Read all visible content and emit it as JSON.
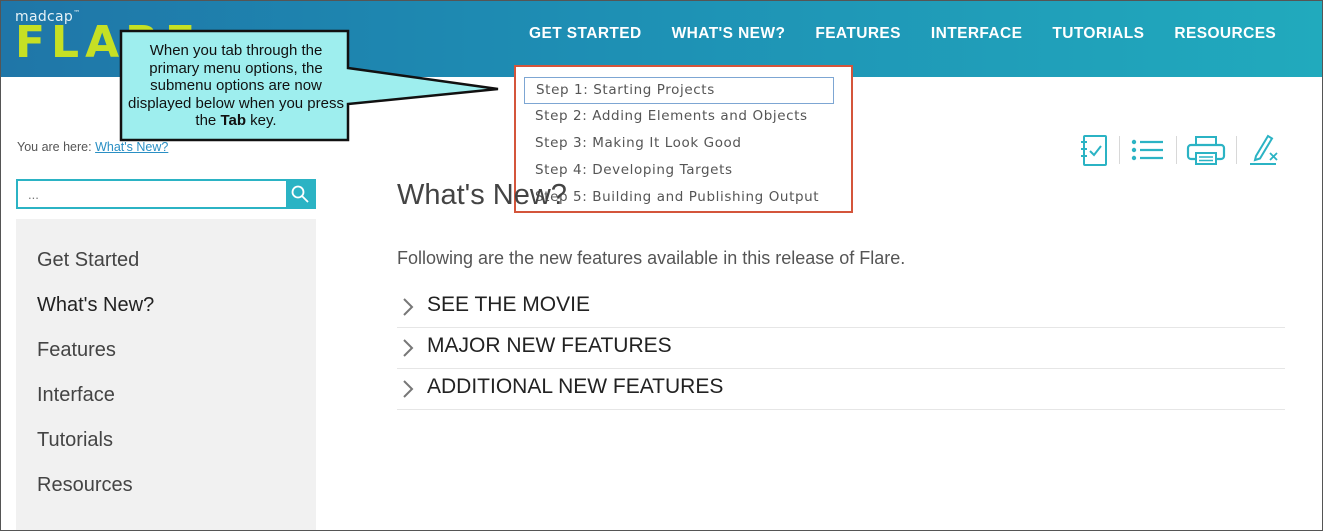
{
  "header": {
    "logo_alt": "madcap",
    "logo_tm": "™",
    "logo_text": "FLARE",
    "nav": [
      "GET STARTED",
      "WHAT'S NEW?",
      "FEATURES",
      "INTERFACE",
      "TUTORIALS",
      "RESOURCES"
    ]
  },
  "callout": {
    "text_before": "When you tab through the primary menu options, the submenu options are now displayed below when you press the ",
    "bold": "Tab",
    "text_after": " key."
  },
  "submenu": {
    "items": [
      "Step 1: Starting Projects",
      "Step 2: Adding Elements and Objects",
      "Step 3: Making It Look Good",
      "Step 4: Developing Targets",
      "Step 5: Building and Publishing Output"
    ],
    "active_index": 0
  },
  "breadcrumb": {
    "prefix": "You are here: ",
    "link": "What's New?"
  },
  "search": {
    "placeholder": "..."
  },
  "sidenav": {
    "items": [
      "Get Started",
      "What's New?",
      "Features",
      "Interface",
      "Tutorials",
      "Resources"
    ],
    "current": "What's New?"
  },
  "toolbar": {
    "icons": [
      "checklist-icon",
      "list-icon",
      "print-icon",
      "clear-highlight-icon"
    ]
  },
  "main": {
    "title": "What's New?",
    "intro": "Following are the new features available in this release of Flare.",
    "dropdowns": [
      "SEE THE MOVIE",
      "MAJOR NEW FEATURES",
      "ADDITIONAL NEW FEATURES"
    ]
  },
  "colors": {
    "header_start": "#1f76a8",
    "header_end": "#21aabd",
    "logo_green": "#c6e024",
    "accent_teal": "#2bb3c4",
    "callout_fill": "#9eeeee",
    "submenu_border": "#d4553b"
  }
}
